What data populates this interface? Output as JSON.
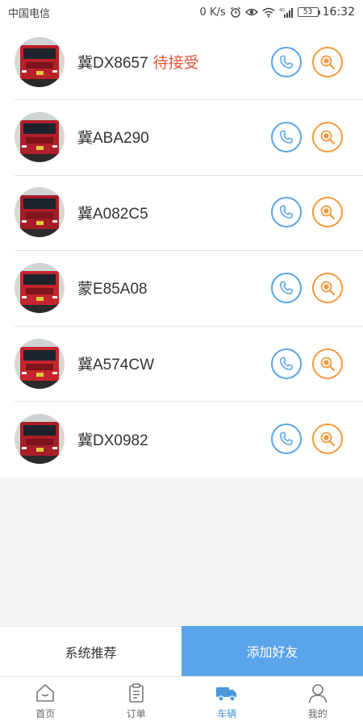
{
  "status_bar": {
    "carrier": "中国电信",
    "speed": "0 K/s",
    "battery": "53",
    "time": "16:32"
  },
  "vehicles": [
    {
      "plate": "冀DX8657",
      "status": "待接受",
      "truck_color": "#b8202a"
    },
    {
      "plate": "冀ABA290",
      "status": "",
      "truck_color": "#b01f2b"
    },
    {
      "plate": "冀A082C5",
      "status": "",
      "truck_color": "#a51c27"
    },
    {
      "plate": "蒙E85A08",
      "status": "",
      "truck_color": "#c2262e"
    },
    {
      "plate": "冀A574CW",
      "status": "",
      "truck_color": "#c4262e"
    },
    {
      "plate": "冀DX0982",
      "status": "",
      "truck_color": "#a81f2a"
    }
  ],
  "action_bar": {
    "recommend_label": "系统推荐",
    "add_friend_label": "添加好友"
  },
  "tabs": [
    {
      "label": "首页",
      "icon": "home-icon"
    },
    {
      "label": "订单",
      "icon": "clipboard-icon"
    },
    {
      "label": "车辆",
      "icon": "truck-icon",
      "active": true
    },
    {
      "label": "我的",
      "icon": "user-icon"
    }
  ],
  "colors": {
    "accent": "#5aa4ea",
    "phone": "#5aa4e6",
    "locate": "#f39a3c",
    "pending": "#e0553a"
  }
}
